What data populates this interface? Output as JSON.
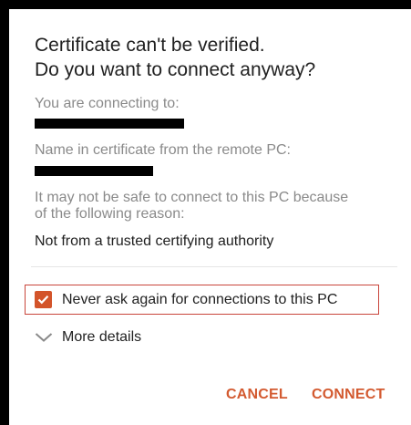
{
  "dialog": {
    "title_line1": "Certificate can't be verified.",
    "title_line2": "Do you want to connect anyway?",
    "connecting_label": "You are connecting to:",
    "cert_name_label": "Name in certificate from the remote PC:",
    "warning_line1": "It may not be safe to connect to this PC because",
    "warning_line2": "of the following reason:",
    "reason": "Not from a trusted certifying authority",
    "never_ask_label": "Never ask again for connections to this PC",
    "never_ask_checked": true,
    "more_details_label": "More details",
    "cancel_label": "CANCEL",
    "connect_label": "CONNECT"
  },
  "colors": {
    "accent": "#d35a30",
    "highlight_border": "#c9453b",
    "secondary_text": "#8a8a8a",
    "primary_text": "#212121"
  },
  "icons": {
    "checkbox": "checkmark-icon",
    "expand": "chevron-down-icon"
  }
}
